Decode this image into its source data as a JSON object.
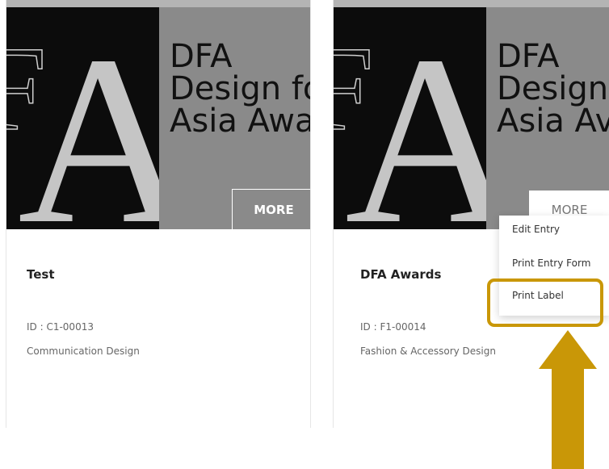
{
  "cards": [
    {
      "banner_title_lines": [
        "DFA",
        "Design fo",
        "Asia Awa"
      ],
      "more_label": "MORE",
      "title": "Test",
      "id_text": "ID : C1-00013",
      "category": "Communication Design"
    },
    {
      "banner_title_lines": [
        "DFA",
        "Design",
        "Asia Av"
      ],
      "more_label": "MORE",
      "title": "DFA Awards",
      "id_text": "ID : F1-00014",
      "category": "Fashion & Accessory Design"
    }
  ],
  "logo": {
    "letters": [
      "F",
      "A"
    ]
  },
  "more_menu": {
    "items": [
      "Edit Entry",
      "Print Entry Form",
      "Print Label"
    ],
    "highlighted_item": "Print Label"
  },
  "colors": {
    "accent_highlight": "#c99707",
    "banner_gray": "#8a8a8a",
    "logo_black": "#0c0c0c"
  }
}
